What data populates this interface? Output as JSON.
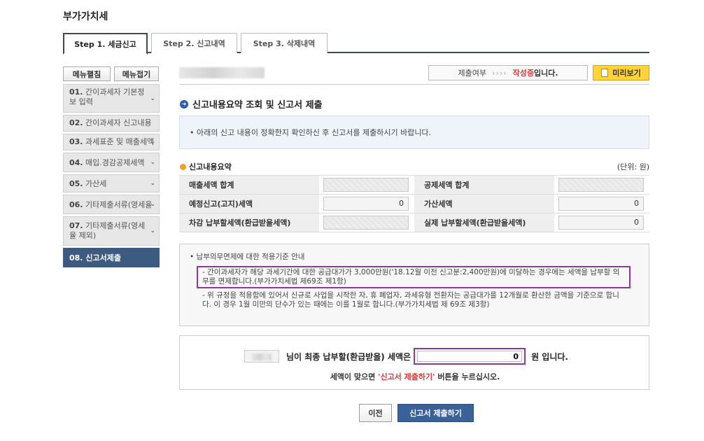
{
  "page": {
    "title": "부가가치세"
  },
  "tabs": [
    {
      "label": "Step 1. 세금신고"
    },
    {
      "label": "Step 2. 신고내역"
    },
    {
      "label": "Step 3. 삭제내역"
    }
  ],
  "side": {
    "expand_label": "메뉴펼침",
    "collapse_label": "메뉴접기",
    "items": [
      {
        "num": "01.",
        "label": "간이과세자 기본정보 입력"
      },
      {
        "num": "02.",
        "label": "간이과세자 신고내용"
      },
      {
        "num": "03.",
        "label": "과세표준 및 매출세액"
      },
      {
        "num": "04.",
        "label": "매입.경감공제세액"
      },
      {
        "num": "05.",
        "label": "가산세"
      },
      {
        "num": "06.",
        "label": "기타제출서류(영세율"
      },
      {
        "num": "07.",
        "label": "기타제출서류(영세율 제외)"
      },
      {
        "num": "08.",
        "label": "신고서제출"
      }
    ]
  },
  "status": {
    "label": "제출여부",
    "arrows": "››››",
    "state": "작성중",
    "suffix": "입니다.",
    "preview_label": "미리보기"
  },
  "section": {
    "title": "신고내용요약 조회 및 신고서 제출",
    "notice": "• 아래의 신고 내용이 정확한지 확인하신 후 신고서를 제출하시기 바랍니다."
  },
  "summary": {
    "title": "신고내용요약",
    "unit": "(단위: 원)",
    "rows": [
      {
        "l_label": "매출세액 합계",
        "l_value": "",
        "r_label": "공제세액 합계",
        "r_value": ""
      },
      {
        "l_label": "예정신고(고지)세액",
        "l_value": "0",
        "r_label": "가산세액",
        "r_value": "0"
      },
      {
        "l_label": "차감 납부할세액(환급받을세액)",
        "l_value": "",
        "r_label": "실제 납부할세액(환급받을세액)",
        "r_value": "0"
      }
    ]
  },
  "rules": {
    "title": "• 납부의무면제에 대한 적용기준 안내",
    "item1": "- 간이과세자가 해당 과세기간에 대한 공급대가가 3,000만원('18.12월 이전 신고분:2,400만원)에 미달하는 경우에는 세액을 납부할 의무를 면제합니다.(부가가치세법 제69조 제1항)",
    "item2": "- 위 규정을 적용함에 있어서 신규로 사업을 시작한 자, 휴 폐업자, 과세유형 전환자는 공급대가를 12개월로 환산한 금액을 기준으로 합니다. 이 경우 1월 미만의 단수가 있는 때에는 이를 1월로 합니다.(부가가치세법 제 69조 제3항)"
  },
  "final": {
    "text1": "님이 최종 납부할(환급받을) 세액은",
    "amount": "0",
    "text2": "원 입니다.",
    "note_pre": "세액이 맞으면 ",
    "note_red": "'신고서 제출하기'",
    "note_post": " 버튼을 누르십시오."
  },
  "buttons": {
    "prev_label": "이전",
    "submit_label": "신고서 제출하기"
  }
}
